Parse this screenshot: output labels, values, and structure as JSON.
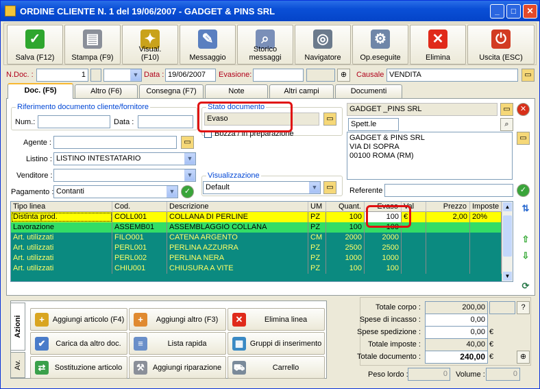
{
  "window": {
    "title": "ORDINE CLIENTE N. 1   del 19/06/2007 - GADGET & PINS SRL",
    "min": "_",
    "max": "□",
    "close": "✕"
  },
  "toolbar": [
    {
      "label": "Salva (F12)",
      "icon": "save-check-icon",
      "color": "#2ea62e",
      "glyph": "✓"
    },
    {
      "label": "Stampa (F9)",
      "icon": "printer-icon",
      "color": "#8a8f99",
      "glyph": "▤"
    },
    {
      "label": "Visual. (F10)",
      "icon": "magic-wand-icon",
      "color": "#c9a21b",
      "glyph": "✦"
    },
    {
      "label": "Messaggio",
      "icon": "pen-paper-icon",
      "color": "#5a7fc0",
      "glyph": "✎"
    },
    {
      "label": "Storico messaggi",
      "icon": "magnifier-doc-icon",
      "color": "#7a8fb8",
      "glyph": "⌕"
    },
    {
      "label": "Navigatore",
      "icon": "compass-icon",
      "color": "#6b7a8c",
      "glyph": "◎"
    },
    {
      "label": "Op.eseguite",
      "icon": "gears-icon",
      "color": "#6f86a8",
      "glyph": "⚙"
    },
    {
      "label": "Elimina",
      "icon": "delete-x-icon",
      "color": "#e02a1a",
      "glyph": "✕"
    },
    {
      "label": "Uscita (ESC)",
      "icon": "exit-power-icon",
      "color": "#d23b22",
      "glyph": "⏻"
    }
  ],
  "header": {
    "ndoc_label": "N.Doc. :",
    "ndoc_value": "1",
    "data_label": "Data :",
    "data_value": "19/06/2007",
    "evasione_label": "Evasione:",
    "evasione_value": "",
    "causale_label": "Causale :",
    "causale_value": "VENDITA"
  },
  "tabs": [
    "Doc. (F5)",
    "Altro (F6)",
    "Consegna (F7)",
    "Note",
    "Altri campi",
    "Documenti"
  ],
  "rif": {
    "title": "Riferimento documento cliente/fornitore",
    "num_label": "Num.:",
    "num_value": "",
    "data_label": "Data :",
    "data_value": ""
  },
  "stato": {
    "title": "Stato documento",
    "value": "Evaso",
    "checkbox_label": "Bozza / in preparazione"
  },
  "form": {
    "agente_label": "Agente :",
    "agente_value": "",
    "listino_label": "Listino :",
    "listino_value": "LISTINO INTESTATARIO",
    "venditore_label": "Venditore :",
    "venditore_value": "",
    "pagamento_label": "Pagamento :",
    "pagamento_value": "Contanti"
  },
  "visual": {
    "title": "Visualizzazione",
    "value": "Default"
  },
  "cliente": {
    "name": "GADGET _PINS SRL",
    "spett": "Spett.le",
    "address_lines": [
      "GADGET & PINS SRL",
      "VIA DI SOPRA",
      "00100 ROMA (RM)"
    ],
    "referente_label": "Referente",
    "referente_value": ""
  },
  "grid": {
    "headers": [
      "Tipo linea",
      "Cod.",
      "Descrizione",
      "UM",
      "Quant.",
      "Evaso",
      "Val",
      "Prezzo",
      "Imposte"
    ],
    "rows": [
      {
        "tipo": "Distinta prod.",
        "cod": "COLL001",
        "desc": "COLLANA DI PERLINE",
        "um": "PZ",
        "quant": "100",
        "evaso": "100",
        "val": "€",
        "prezzo": "2,00",
        "imposte": "20%",
        "style": "yellow"
      },
      {
        "tipo": "Lavorazione",
        "cod": "ASSEMB01",
        "desc": "ASSEMBLAGGIO COLLANA",
        "um": "PZ",
        "quant": "100",
        "evaso": "100",
        "val": "",
        "prezzo": "",
        "imposte": "",
        "style": "green"
      },
      {
        "tipo": "Art. utilizzati",
        "cod": "FILO001",
        "desc": "CATENA ARGENTO",
        "um": "CM",
        "quant": "2000",
        "evaso": "2000",
        "val": "",
        "prezzo": "",
        "imposte": "",
        "style": "teal"
      },
      {
        "tipo": "Art. utilizzati",
        "cod": "PERL001",
        "desc": "PERLINA AZZURRA",
        "um": "PZ",
        "quant": "2500",
        "evaso": "2500",
        "val": "",
        "prezzo": "",
        "imposte": "",
        "style": "teal"
      },
      {
        "tipo": "Art. utilizzati",
        "cod": "PERL002",
        "desc": "PERLINA NERA",
        "um": "PZ",
        "quant": "1000",
        "evaso": "1000",
        "val": "",
        "prezzo": "",
        "imposte": "",
        "style": "teal"
      },
      {
        "tipo": "Art. utilizzati",
        "cod": "CHIU001",
        "desc": "CHIUSURA A VITE",
        "um": "PZ",
        "quant": "100",
        "evaso": "100",
        "val": "",
        "prezzo": "",
        "imposte": "",
        "style": "teal"
      }
    ]
  },
  "actions": {
    "tab_azioni": "Azioni",
    "tab_av": "Av.",
    "buttons": [
      {
        "label": "Aggiungi articolo (F4)",
        "icon": "add-box-icon",
        "color": "#d9a520",
        "glyph": "+"
      },
      {
        "label": "Aggiungi altro (F3)",
        "icon": "add-grid-icon",
        "color": "#e08a30",
        "glyph": "+"
      },
      {
        "label": "Elimina linea",
        "icon": "delete-line-icon",
        "color": "#e02a1a",
        "glyph": "✕"
      },
      {
        "label": "Carica da altro doc.",
        "icon": "load-doc-icon",
        "color": "#4a7cc9",
        "glyph": "✔"
      },
      {
        "label": "Lista rapida",
        "icon": "quick-list-icon",
        "color": "#6a8fc9",
        "glyph": "≡"
      },
      {
        "label": "Gruppi di inserimento",
        "icon": "group-insert-icon",
        "color": "#3a8ac4",
        "glyph": "▦"
      },
      {
        "label": "Sostituzione articolo",
        "icon": "replace-item-icon",
        "color": "#3aa04a",
        "glyph": "⇄"
      },
      {
        "label": "Aggiungi riparazione",
        "icon": "wrench-icon",
        "color": "#8a8f99",
        "glyph": "⚒"
      },
      {
        "label": "Carrello",
        "icon": "cart-icon",
        "color": "#7a8a9a",
        "glyph": "⛟"
      }
    ]
  },
  "totals": {
    "corpo_label": "Totale corpo :",
    "corpo": "200,00",
    "help": "?",
    "incasso_label": "Spese di incasso :",
    "incasso": "0,00",
    "spedizione_label": "Spese spedizione :",
    "spedizione": "0,00",
    "spedizione_cur": "€",
    "imposte_label": "Totale imposte :",
    "imposte": "40,00",
    "imposte_cur": "€",
    "documento_label": "Totale documento :",
    "documento": "240,00",
    "documento_cur": "€",
    "peso_label": "Peso lordo :",
    "peso": "0",
    "volume_label": "Volume :",
    "volume": "0"
  }
}
